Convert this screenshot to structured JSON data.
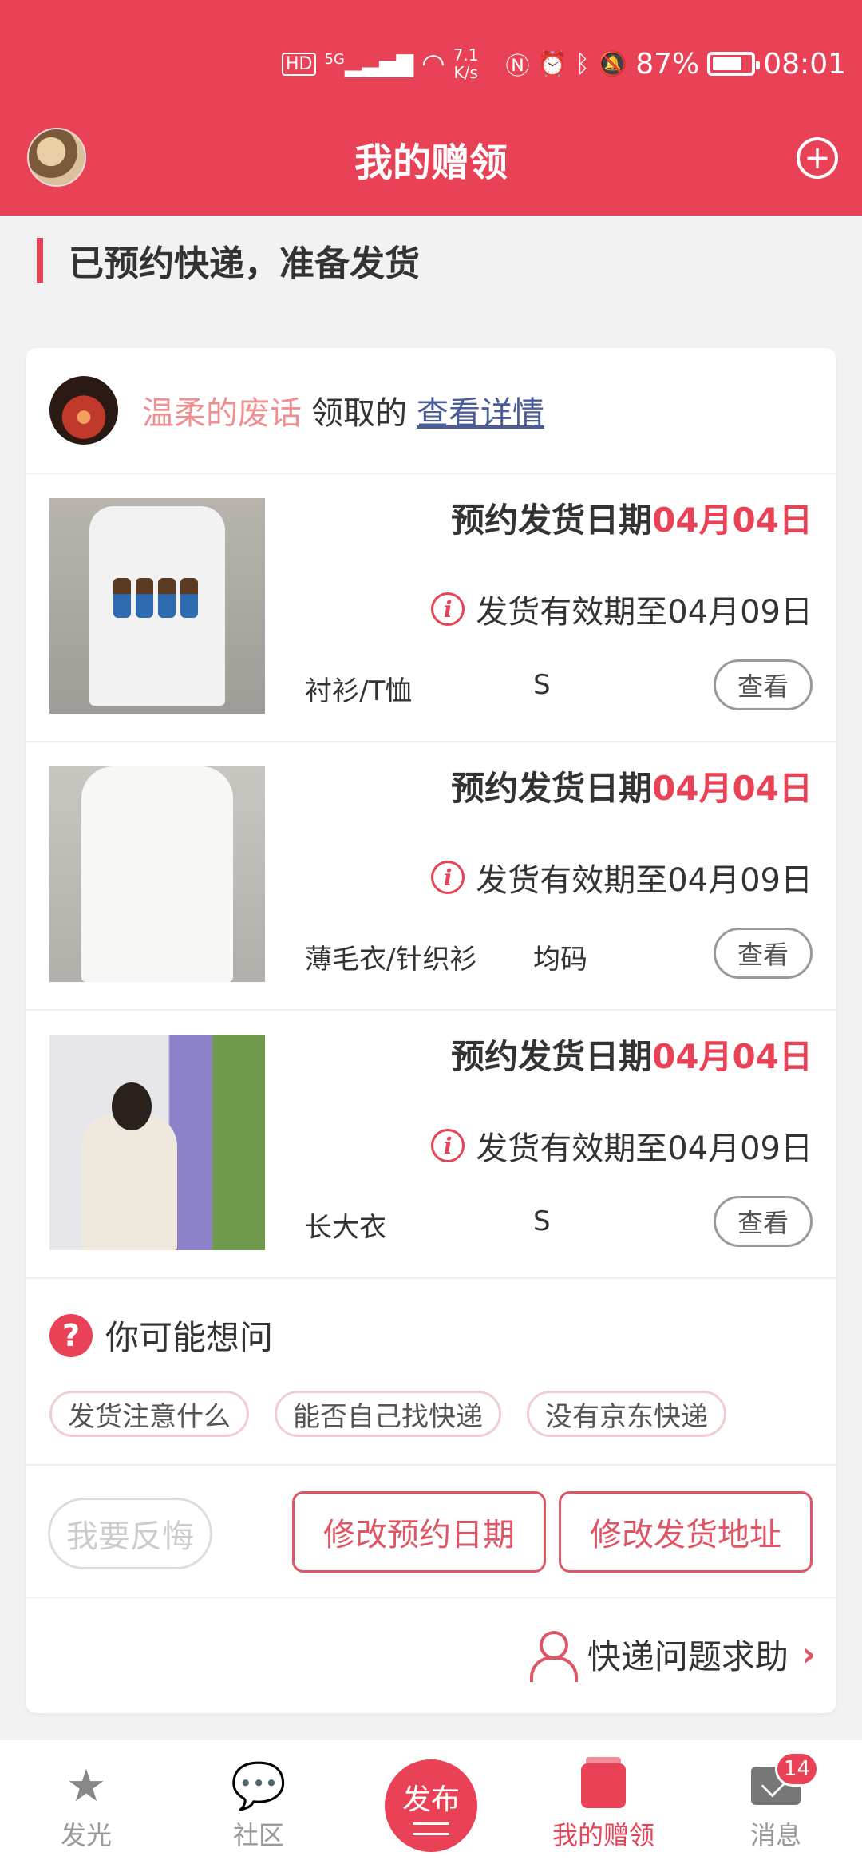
{
  "status_bar": {
    "hd": "HD",
    "net_type": "5G",
    "speed_value": "7.1",
    "speed_unit": "K/s",
    "battery": "87%",
    "time": "08:01"
  },
  "header": {
    "title": "我的赠领"
  },
  "section": {
    "heading": "已预约快递，准备发货"
  },
  "card": {
    "user_name": "温柔的废话",
    "claimed_text": "领取的",
    "detail_link": "查看详情",
    "items": [
      {
        "reserve_label": "预约发货日期",
        "reserve_date": "04月04日",
        "valid_text": "发货有效期至04月09日",
        "category": "衬衫/T恤",
        "size": "S",
        "view_label": "查看"
      },
      {
        "reserve_label": "预约发货日期",
        "reserve_date": "04月04日",
        "valid_text": "发货有效期至04月09日",
        "category": "薄毛衣/针织衫",
        "size": "均码",
        "view_label": "查看"
      },
      {
        "reserve_label": "预约发货日期",
        "reserve_date": "04月04日",
        "valid_text": "发货有效期至04月09日",
        "category": "长大衣",
        "size": "S",
        "view_label": "查看"
      }
    ],
    "faq": {
      "title": "你可能想问",
      "chips": [
        "发货注意什么",
        "能否自己找快递",
        "没有京东快递"
      ]
    },
    "actions": {
      "regret": "我要反悔",
      "change_date": "修改预约日期",
      "change_address": "修改发货地址"
    },
    "help": {
      "label": "快递问题求助"
    }
  },
  "bottom_nav": {
    "items": [
      {
        "label": "发光",
        "icon": "star-icon"
      },
      {
        "label": "社区",
        "icon": "chat-bubble-icon"
      },
      {
        "label": "发布",
        "icon": "publish-icon"
      },
      {
        "label": "我的赠领",
        "icon": "gift-box-icon"
      },
      {
        "label": "消息",
        "icon": "mail-icon"
      }
    ],
    "messages_badge": "14"
  },
  "colors": {
    "brand": "#e94155",
    "link": "#4a5d99",
    "username": "#ef8f8f"
  }
}
